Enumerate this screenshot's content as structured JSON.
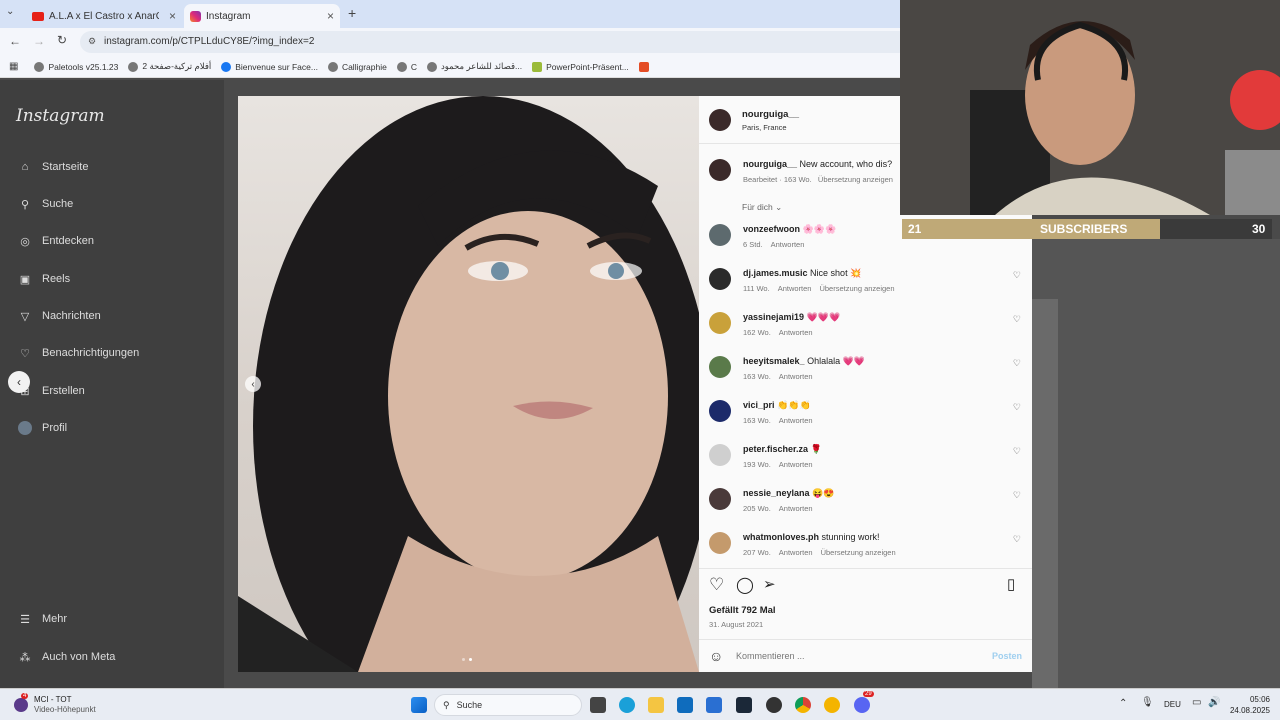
{
  "browser": {
    "tabs": [
      {
        "title": "A.L.A x El Castro x AnarChnow..."
      },
      {
        "title": "Instagram"
      }
    ],
    "url": "instagram.com/p/CTPLLduCY8E/?img_index=2",
    "bookmarks": [
      "Paletools v25.1.23",
      "أفلام تركية-صفحة 2",
      "Bienvenue sur Face...",
      "Calligraphie",
      "C",
      "قصائد للشاعر محمود...",
      "PowerPoint-Präsent..."
    ]
  },
  "sidebar": {
    "logo": "Instagram",
    "items": [
      {
        "label": "Startseite"
      },
      {
        "label": "Suche"
      },
      {
        "label": "Entdecken"
      },
      {
        "label": "Reels"
      },
      {
        "label": "Nachrichten"
      },
      {
        "label": "Benachrichtigungen"
      },
      {
        "label": "Erstellen"
      },
      {
        "label": "Profil"
      }
    ],
    "more": "Mehr",
    "meta": "Auch von Meta"
  },
  "post": {
    "author": "nourguiga__",
    "location": "Paris, France",
    "caption_user": "nourguiga__",
    "caption_text": "New account, who dis?",
    "caption_meta": "Bearbeitet · 163 Wo.",
    "caption_translate": "Übersetzung anzeigen",
    "for_you": "Für dich",
    "comments": [
      {
        "user": "vonzeefwoon",
        "text": "🌸🌸🌸",
        "time": "6 Std.",
        "reply": "Antworten",
        "translate": ""
      },
      {
        "user": "dj.james.music",
        "text": "Nice shot 💥",
        "time": "111 Wo.",
        "reply": "Antworten",
        "translate": "Übersetzung anzeigen"
      },
      {
        "user": "yassinejami19",
        "text": "💗💗💗",
        "time": "162 Wo.",
        "reply": "Antworten",
        "translate": ""
      },
      {
        "user": "heeyitsmalek_",
        "text": "Ohlalala 💗💗",
        "time": "163 Wo.",
        "reply": "Antworten",
        "translate": ""
      },
      {
        "user": "vici_pri",
        "text": "👏👏👏",
        "time": "163 Wo.",
        "reply": "Antworten",
        "translate": ""
      },
      {
        "user": "peter.fischer.za",
        "text": "🌹",
        "time": "193 Wo.",
        "reply": "Antworten",
        "translate": ""
      },
      {
        "user": "nessie_neylana",
        "text": "😝😍",
        "time": "205 Wo.",
        "reply": "Antworten",
        "translate": ""
      },
      {
        "user": "whatmonloves.ph",
        "text": "stunning work!",
        "time": "207 Wo.",
        "reply": "Antworten",
        "translate": "Übersetzung anzeigen"
      }
    ],
    "likes": "Gefällt 792 Mal",
    "date": "31. August 2021",
    "comment_placeholder": "Kommentieren ...",
    "post_button": "Posten"
  },
  "overlay": {
    "sub_count": "21",
    "sub_label": "SUBSCRIBERS",
    "sub_goal": "30"
  },
  "taskbar": {
    "app_title": "MCI - TOT",
    "app_subtitle": "Video-Höhepunkt",
    "badge": "4",
    "search": "Suche",
    "lang": "DEU",
    "time": "05:06",
    "date": "24.08.2025",
    "discord_badge": "29"
  },
  "colors": {
    "accent": "#0095f6",
    "sub_fill": "#bfa977",
    "heart": "#e0245e"
  }
}
